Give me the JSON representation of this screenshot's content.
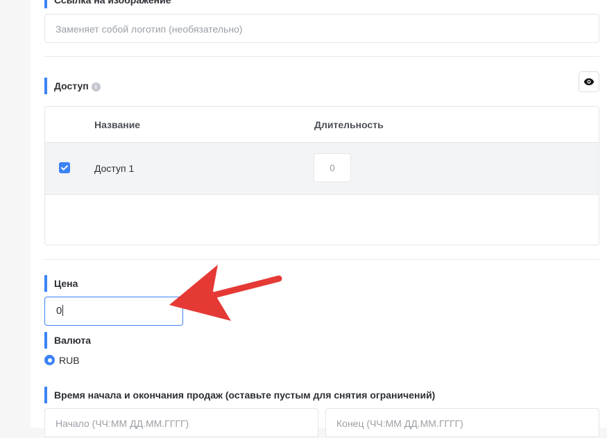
{
  "image_link": {
    "label": "Ссылка на изображение",
    "placeholder": "Заменяет собой логотип (необязательно)"
  },
  "access": {
    "label": "Доступ",
    "info_icon": "info-icon",
    "visibility_icon": "eye-icon",
    "table": {
      "columns": [
        "Название",
        "Длительность"
      ],
      "rows": [
        {
          "checked": true,
          "name": "Доступ 1",
          "duration_placeholder": "0"
        }
      ]
    }
  },
  "price": {
    "label": "Цена",
    "value": "0"
  },
  "currency": {
    "label": "Валюта",
    "options": [
      {
        "label": "RUB",
        "selected": true
      }
    ]
  },
  "sales_time": {
    "label": "Время начала и окончания продаж (оставьте пустым для снятия ограничений)",
    "start_placeholder": "Начало (ЧЧ:ММ ДД.ММ.ГГГГ)",
    "end_placeholder": "Конец (ЧЧ:ММ ДД.ММ.ГГГГ)"
  },
  "colors": {
    "accent": "#3b82f6",
    "annotation_arrow": "#e53935"
  }
}
